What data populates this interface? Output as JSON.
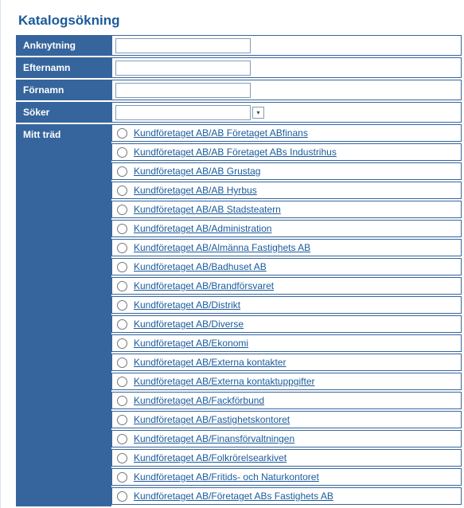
{
  "title": "Katalogsökning",
  "labels": {
    "anknytning": "Anknytning",
    "efternamn": "Efternamn",
    "fornamn": "Förnamn",
    "soker": "Söker",
    "mitt_trad": "Mitt träd"
  },
  "fields": {
    "anknytning": "",
    "efternamn": "",
    "fornamn": "",
    "soker": ""
  },
  "tree": [
    "Kundföretaget AB/AB Företaget ABfinans",
    "Kundföretaget AB/AB Företaget ABs Industrihus",
    "Kundföretaget AB/AB Grustag",
    "Kundföretaget AB/AB Hyrbus",
    "Kundföretaget AB/AB Stadsteatern",
    "Kundföretaget AB/Administration",
    "Kundföretaget AB/Almänna Fastighets AB",
    "Kundföretaget AB/Badhuset AB",
    "Kundföretaget AB/Brandförsvaret",
    "Kundföretaget AB/Distrikt",
    "Kundföretaget AB/Diverse",
    "Kundföretaget AB/Ekonomi",
    "Kundföretaget AB/Externa kontakter",
    "Kundföretaget AB/Externa kontaktuppgifter",
    "Kundföretaget AB/Fackförbund",
    "Kundföretaget AB/Fastighetskontoret",
    "Kundföretaget AB/Finansförvaltningen",
    "Kundföretaget AB/Folkrörelsearkivet",
    "Kundföretaget AB/Fritids- och Naturkontoret",
    "Kundföretaget AB/Företaget ABs Fastighets AB"
  ]
}
